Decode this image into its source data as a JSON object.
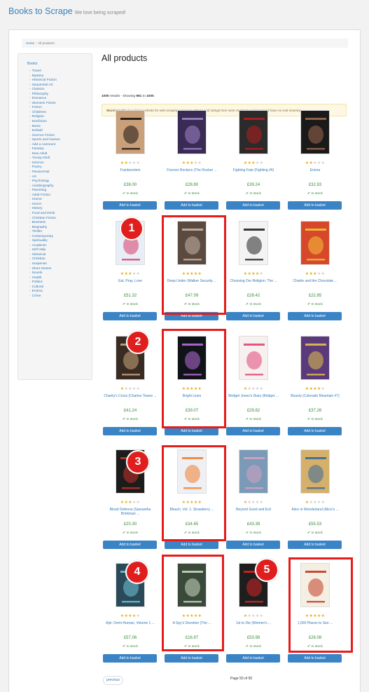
{
  "header": {
    "brand": "Books to Scrape",
    "tagline": "We love being scraped!"
  },
  "breadcrumb": {
    "home": "Home",
    "current": "All products"
  },
  "sidebar": {
    "root": "Books",
    "categories": [
      "Travel",
      "Mystery",
      "Historical Fiction",
      "Sequential Art",
      "Classics",
      "Philosophy",
      "Romance",
      "Womens Fiction",
      "Fiction",
      "Childrens",
      "Religion",
      "Nonfiction",
      "Music",
      "Default",
      "Science Fiction",
      "Sports and Games",
      "Add a comment",
      "Fantasy",
      "New Adult",
      "Young Adult",
      "Science",
      "Poetry",
      "Paranormal",
      "Art",
      "Psychology",
      "Autobiography",
      "Parenting",
      "Adult Fiction",
      "Humor",
      "Horror",
      "History",
      "Food and Drink",
      "Christian Fiction",
      "Business",
      "Biography",
      "Thriller",
      "Contemporary",
      "Spirituality",
      "Academic",
      "Self Help",
      "Historical",
      "Christian",
      "Suspense",
      "Short Stories",
      "Novels",
      "Health",
      "Politics",
      "Cultural",
      "Erotica",
      "Crime"
    ]
  },
  "main": {
    "title": "All products",
    "results_total": "1000",
    "results_text": " results - showing ",
    "results_from": "981",
    "results_to_text": " to ",
    "results_to": "1000",
    "results_end": ".",
    "warning_strong": "Warning!",
    "warning_text": " This is a demo website for web scraping purposes. Prices and ratings here were randomly assigned and have no real meaning."
  },
  "products": [
    {
      "title": "Frankenstein",
      "rating": 2,
      "price": "£38.00",
      "stock": "In stock",
      "button": "Add to basket",
      "cover_bg": "#caa07a",
      "cover_fg": "#1a1410"
    },
    {
      "title": "Forever Rockers (The Rocker ...",
      "rating": 3,
      "price": "£28.80",
      "stock": "In stock",
      "button": "Add to basket",
      "cover_bg": "#3a2b55",
      "cover_fg": "#9e86c8"
    },
    {
      "title": "Fighting Fate (Fighting #6)",
      "rating": 3,
      "price": "£39.24",
      "stock": "In stock",
      "button": "Add to basket",
      "cover_bg": "#2b2b2b",
      "cover_fg": "#b81e1e"
    },
    {
      "title": "Emma",
      "rating": 2,
      "price": "£32.93",
      "stock": "In stock",
      "button": "Add to basket",
      "cover_bg": "#1a1a1a",
      "cover_fg": "#a06a50"
    },
    {
      "title": "Eat, Pray, Love",
      "rating": 3,
      "price": "£51.32",
      "stock": "In stock",
      "button": "Add to basket",
      "cover_bg": "#e8eef5",
      "cover_fg": "#d83a6a"
    },
    {
      "title": "Deep Under (Walker Security ...",
      "rating": 5,
      "price": "£47.09",
      "stock": "In stock",
      "button": "Add to basket",
      "cover_bg": "#5a4a40",
      "cover_fg": "#c7b7a5"
    },
    {
      "title": "Choosing Our Religion: The ...",
      "rating": 4,
      "price": "£28.42",
      "stock": "In stock",
      "button": "Add to basket",
      "cover_bg": "#f3f3f3",
      "cover_fg": "#222222"
    },
    {
      "title": "Charlie and the Chocolate ...",
      "rating": 3,
      "price": "£22.85",
      "stock": "In stock",
      "button": "Add to basket",
      "cover_bg": "#d7482a",
      "cover_fg": "#f3c23a"
    },
    {
      "title": "Charity's Cross (Charles Towne ...",
      "rating": 1,
      "price": "£41.24",
      "stock": "In stock",
      "button": "Add to basket",
      "cover_bg": "#3a2a24",
      "cover_fg": "#c9a57a"
    },
    {
      "title": "Bright Lines",
      "rating": 5,
      "price": "£39.07",
      "stock": "In stock",
      "button": "Add to basket",
      "cover_bg": "#101418",
      "cover_fg": "#b86bd8"
    },
    {
      "title": "Bridget Jones's Diary (Bridget ...",
      "rating": 1,
      "price": "£29.82",
      "stock": "In stock",
      "button": "Add to basket",
      "cover_bg": "#f6f0ee",
      "cover_fg": "#e0457a"
    },
    {
      "title": "Bounty (Colorado Mountain #7)",
      "rating": 4,
      "price": "£37.26",
      "stock": "In stock",
      "button": "Add to basket",
      "cover_bg": "#5a3a7a",
      "cover_fg": "#e3c14a"
    },
    {
      "title": "Blood Defense (Samantha Brinkman ...",
      "rating": 3,
      "price": "£20.30",
      "stock": "In stock",
      "button": "Add to basket",
      "cover_bg": "#1c1c1c",
      "cover_fg": "#c8322a"
    },
    {
      "title": "Bleach, Vol. 1: Strawberry ...",
      "rating": 5,
      "price": "£34.65",
      "stock": "In stock",
      "button": "Add to basket",
      "cover_bg": "#eef0f4",
      "cover_fg": "#f08030"
    },
    {
      "title": "Beyond Good and Evil",
      "rating": 1,
      "price": "£43.38",
      "stock": "In stock",
      "button": "Add to basket",
      "cover_bg": "#7a9ab8",
      "cover_fg": "#d4a2c0"
    },
    {
      "title": "Alice in Wonderland (Alice's ...",
      "rating": 1,
      "price": "£55.53",
      "stock": "In stock",
      "button": "Add to basket",
      "cover_bg": "#d4b06a",
      "cover_fg": "#3a6a9a"
    },
    {
      "title": "Ajin: Demi-Human, Volume 1 ...",
      "rating": 4,
      "price": "£57.06",
      "stock": "In stock",
      "button": "Add to basket",
      "cover_bg": "#2a4a5a",
      "cover_fg": "#6fc4d8"
    },
    {
      "title": "A Spy's Devotion (The ...",
      "rating": 5,
      "price": "£16.97",
      "stock": "In stock",
      "button": "Add to basket",
      "cover_bg": "#3a4a3a",
      "cover_fg": "#c8d8c0"
    },
    {
      "title": "1st to Die (Women's ...",
      "rating": 1,
      "price": "£53.98",
      "stock": "In stock",
      "button": "Add to basket",
      "cover_bg": "#1e1e1e",
      "cover_fg": "#d62424"
    },
    {
      "title": "1,000 Places to See ...",
      "rating": 5,
      "price": "£26.08",
      "stock": "In stock",
      "button": "Add to basket",
      "cover_bg": "#f4efe2",
      "cover_fg": "#c23a22"
    }
  ],
  "annotations": [
    "1",
    "2",
    "3",
    "4",
    "5"
  ],
  "pagination": {
    "previous": "previous",
    "info": "Page 50 of 50"
  },
  "colors": {
    "highlight": "#e81b1b",
    "button": "#3a84c6",
    "link": "#337ab7",
    "stock": "#3c8a3c",
    "star": "#e5b21a"
  }
}
